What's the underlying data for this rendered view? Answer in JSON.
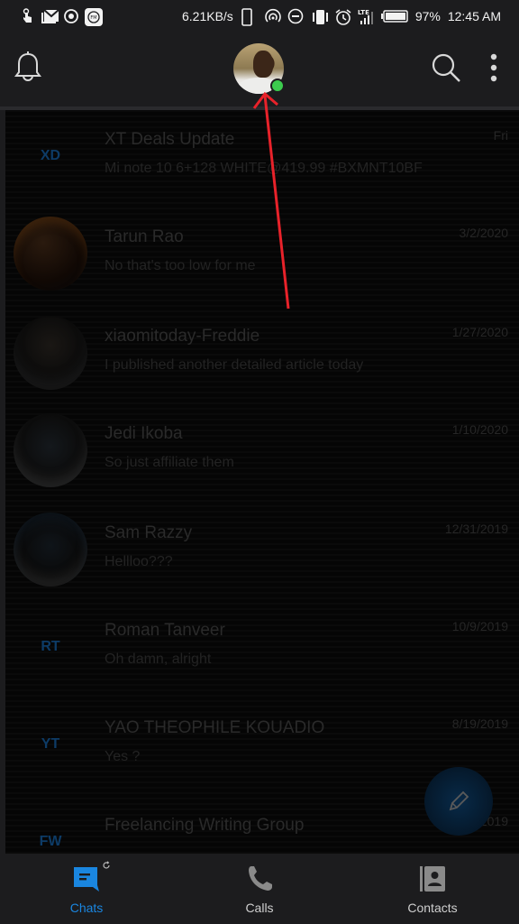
{
  "status_bar": {
    "left_icons": [
      "touch-gesture-icon",
      "gmail-icon",
      "record-icon",
      "fm-radio-icon"
    ],
    "network_speed": "6.21KB/s",
    "right_icons": [
      "phone-outline-icon",
      "hotspot-icon",
      "do-not-disturb-icon",
      "vibrate-icon",
      "alarm-icon",
      "lte-signal-icon",
      "battery-icon"
    ],
    "network_type": "LTE",
    "battery": "97%",
    "time": "12:45 AM"
  },
  "app_bar": {
    "notifications_icon": "bell-icon",
    "profile_status": "online",
    "search_icon": "search-icon",
    "more_icon": "more-vertical-icon"
  },
  "colors": {
    "accent": "#1a86e0",
    "online": "#3ccc4e",
    "annotation": "#e8222a",
    "background": "#1c1c1e"
  },
  "chats": [
    {
      "avatar_type": "initials",
      "initials": "XD",
      "name": "XT Deals Update",
      "preview": "Mi note 10 6+128   WHITE@419.99   #BXMNT10BF",
      "date": "Fri"
    },
    {
      "avatar_type": "photo",
      "name": "Tarun Rao",
      "preview": "No that's too low for me",
      "date": "3/2/2020"
    },
    {
      "avatar_type": "photo",
      "name": "xiaomitoday-Freddie",
      "preview": "I published another detailed article today",
      "date": "1/27/2020"
    },
    {
      "avatar_type": "photo",
      "name": "Jedi Ikoba",
      "preview": "So just affiliate them",
      "date": "1/10/2020"
    },
    {
      "avatar_type": "photo",
      "name": "Sam Razzy",
      "preview": "Hellloo???",
      "date": "12/31/2019"
    },
    {
      "avatar_type": "initials",
      "initials": "RT",
      "name": "Roman Tanveer",
      "preview": "Oh damn, alright",
      "date": "10/9/2019"
    },
    {
      "avatar_type": "initials",
      "initials": "YT",
      "name": "YAO THEOPHILE KOUADIO",
      "preview": "Yes ?",
      "date": "8/19/2019"
    },
    {
      "avatar_type": "initials",
      "initials": "FW",
      "name": "Freelancing Writing Group",
      "preview": "",
      "date": "2019"
    }
  ],
  "fab": {
    "icon": "pencil-icon",
    "label": "New chat"
  },
  "bottom_nav": {
    "tabs": [
      {
        "label": "Chats",
        "icon": "chat-bubble-icon",
        "active": true
      },
      {
        "label": "Calls",
        "icon": "phone-icon",
        "active": false
      },
      {
        "label": "Contacts",
        "icon": "contact-book-icon",
        "active": false
      }
    ],
    "sync_icon": "sync-icon"
  }
}
